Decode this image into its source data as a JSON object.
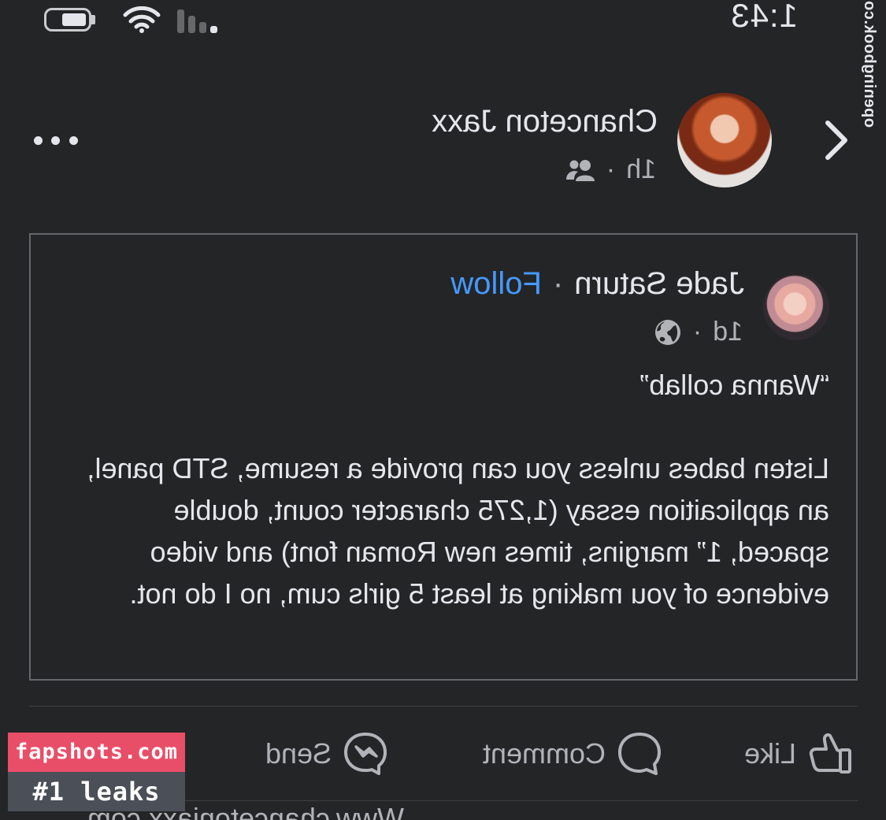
{
  "status_bar": {
    "time": "1:43"
  },
  "side_watermark": "openingbook.com",
  "post": {
    "author": "Chanceton Jaxx",
    "time": "1h",
    "separator": "·",
    "audience_icon": "friends-icon"
  },
  "shared_post": {
    "author": "Jade Saturn",
    "separator": "·",
    "follow_label": "Follow",
    "time": "1d",
    "audience_icon": "globe-icon",
    "title": "“Wanna collab”",
    "body": "Listen babes unless you can provide a resume, STD panel, an applicaition essay (1,275 character count, double spaced, 1” margins, times new Roman font) and video evidence of you making at least 5 girls cum, no I do not."
  },
  "actions": {
    "like": "Like",
    "comment": "Comment",
    "send": "Send"
  },
  "footer_cut_text": "Www.chancetonjaxx.com",
  "badge": {
    "line1": "fapshots.com",
    "line2": "#1 leaks"
  },
  "colors": {
    "background": "#242526",
    "text": "#e4e6eb",
    "secondary_text": "#b0b3b8",
    "link": "#4599ff",
    "badge_pink": "#e94e68",
    "badge_gray": "#4b4f58"
  }
}
